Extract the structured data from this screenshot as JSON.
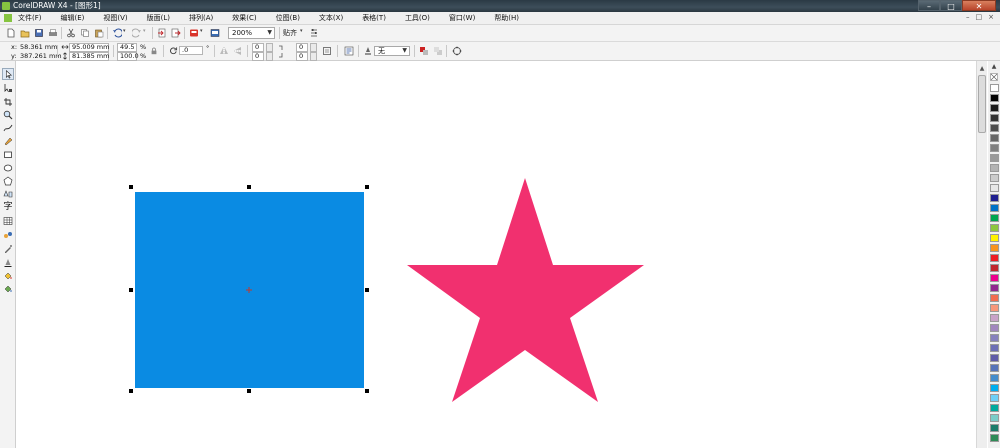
{
  "window": {
    "title": "CorelDRAW X4 - [图形1]",
    "controls": [
      "–",
      "□",
      "✕"
    ],
    "doc_controls": [
      "–",
      "□",
      "×"
    ]
  },
  "menu": {
    "items": [
      "文件(F)",
      "编辑(E)",
      "视图(V)",
      "版面(L)",
      "排列(A)",
      "效果(C)",
      "位图(B)",
      "文本(X)",
      "表格(T)",
      "工具(O)",
      "窗口(W)",
      "帮助(H)"
    ]
  },
  "toolbar": {
    "zoom_value": "200%",
    "snap_label": "贴齐"
  },
  "properties": {
    "x_label": "x:",
    "x_value": "58.361 mm",
    "y_label": "y:",
    "y_value": "387.261 mm",
    "width_value": "95.009 mm",
    "height_value": "81.385 mm",
    "scale_x": "49.5",
    "scale_y": "100.0",
    "percent_sign": "%",
    "rotation_value": ".0",
    "degree_sign": "°",
    "corner_tl": "0",
    "corner_bl": "0",
    "corner_tr": "0",
    "corner_br": "0",
    "outline_value": "无"
  },
  "shapes": {
    "rectangle_fill": "#0a8be3",
    "star_fill": "#f1306f"
  },
  "palette": {
    "colors": [
      "#ffffff",
      "#000000",
      "#1a1a1a",
      "#333333",
      "#4d4d4d",
      "#666666",
      "#808080",
      "#999999",
      "#b3b3b3",
      "#cccccc",
      "#e6e6e6",
      "#1f1f8f",
      "#0072c6",
      "#00a651",
      "#8dc63f",
      "#fff200",
      "#f7941d",
      "#ed1c24",
      "#c1272d",
      "#ec008c",
      "#92278f",
      "#f26c4f",
      "#f7977a",
      "#c8a2c8",
      "#a186be",
      "#8781bd",
      "#6d6fb6",
      "#605ca8",
      "#5674b9",
      "#448ccb",
      "#00aeef",
      "#6dcff6",
      "#00a99d",
      "#7accc8",
      "#1b7c6a",
      "#2e8b57"
    ]
  }
}
